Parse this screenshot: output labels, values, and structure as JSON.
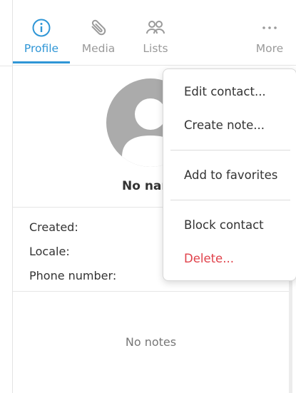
{
  "tabs": {
    "profile": {
      "label": "Profile",
      "icon": "info-circle-icon"
    },
    "media": {
      "label": "Media",
      "icon": "paperclip-icon"
    },
    "lists": {
      "label": "Lists",
      "icon": "users-icon"
    },
    "more": {
      "label": "More",
      "icon": "ellipsis-icon"
    }
  },
  "profile": {
    "name": "No nar",
    "fields": {
      "created": "Created:",
      "locale": "Locale:",
      "phone": "Phone number:"
    },
    "notes_empty": "No notes"
  },
  "menu": {
    "edit": "Edit contact...",
    "create_note": "Create note...",
    "favorites": "Add to favorites",
    "block": "Block contact",
    "delete": "Delete..."
  },
  "colors": {
    "accent": "#2f96d6",
    "danger": "#e0414a",
    "avatar": "#ababab"
  }
}
